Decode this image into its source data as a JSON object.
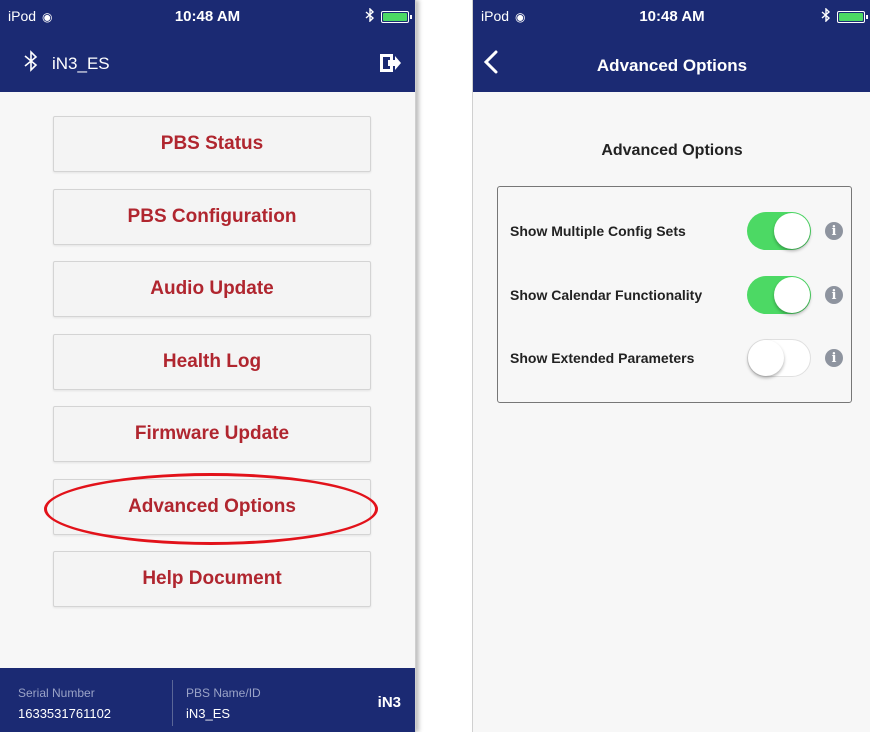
{
  "left": {
    "status": {
      "carrier": "iPod",
      "time": "10:48 AM"
    },
    "device_name": "iN3_ES",
    "menu": [
      {
        "label": "PBS Status"
      },
      {
        "label": "PBS Configuration"
      },
      {
        "label": "Audio Update"
      },
      {
        "label": "Health Log"
      },
      {
        "label": "Firmware Update"
      },
      {
        "label": "Advanced Options"
      },
      {
        "label": "Help Document"
      }
    ],
    "footer": {
      "serial_label": "Serial Number",
      "serial_value": "1633531761102",
      "pbs_label": "PBS Name/ID",
      "pbs_value": "iN3_ES",
      "model": "iN3"
    }
  },
  "right": {
    "status": {
      "carrier": "iPod",
      "time": "10:48 AM"
    },
    "nav_title": "Advanced Options",
    "section_title": "Advanced Options",
    "options": [
      {
        "label": "Show Multiple Config Sets",
        "on": true
      },
      {
        "label": "Show Calendar Functionality",
        "on": true
      },
      {
        "label": "Show Extended Parameters",
        "on": false
      }
    ]
  },
  "colors": {
    "navbar": "#1b2a73",
    "accent_text": "#b0262f",
    "toggle_on": "#4cd964",
    "highlight": "#e2121a"
  }
}
